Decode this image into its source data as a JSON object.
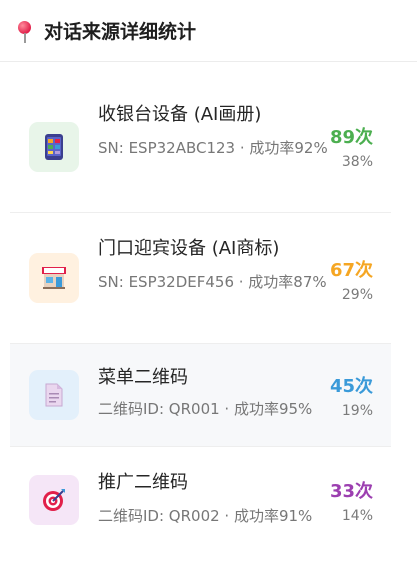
{
  "header": {
    "title": "对话来源详细统计",
    "icon": "pushpin-icon"
  },
  "items": [
    {
      "name": "收银台设备 (AI画册)",
      "sub": "SN: ESP32ABC123 · 成功率92%",
      "count": "89次",
      "percent": "38%",
      "icon": "phone-icon",
      "icon_bg": "#e8f5e9",
      "count_color": "#4caf50"
    },
    {
      "name": "门口迎宾设备 (AI商标)",
      "sub": "SN: ESP32DEF456 · 成功率87%",
      "count": "67次",
      "percent": "29%",
      "icon": "shop-icon",
      "icon_bg": "#fff1e0",
      "count_color": "#f5a623"
    },
    {
      "name": "菜单二维码",
      "sub": "二维码ID: QR001 · 成功率95%",
      "count": "45次",
      "percent": "19%",
      "icon": "document-icon",
      "icon_bg": "#e3f0fb",
      "count_color": "#3a9ad9"
    },
    {
      "name": "推广二维码",
      "sub": "二维码ID: QR002 · 成功率91%",
      "count": "33次",
      "percent": "14%",
      "icon": "target-icon",
      "icon_bg": "#f5e6f7",
      "count_color": "#9c3fb0"
    }
  ]
}
